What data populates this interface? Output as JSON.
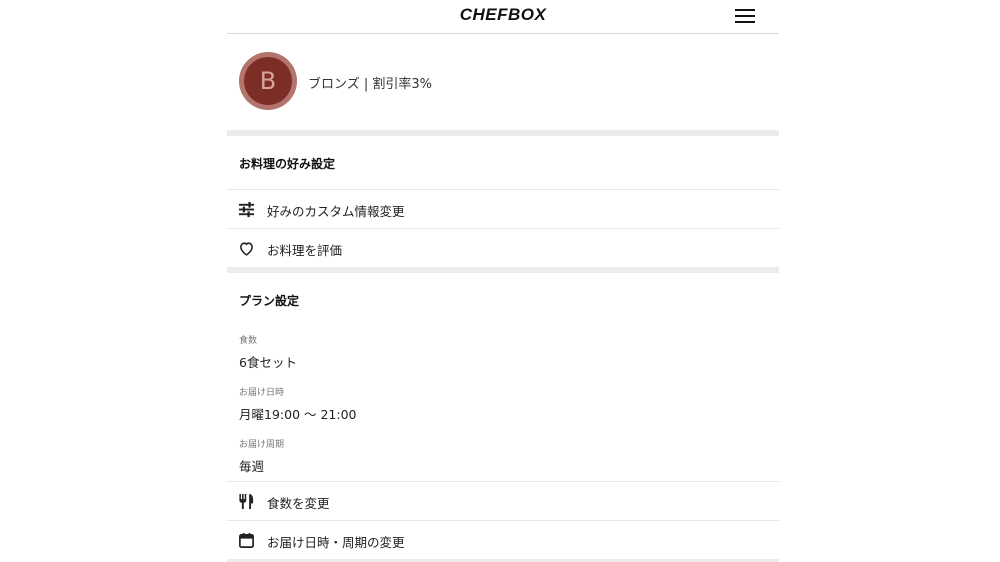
{
  "header": {
    "logo": "CHEFBOX",
    "menu_icon": "hamburger-menu-icon"
  },
  "profile": {
    "avatar_letter": "B",
    "rank_text": "ブロンズ | 割引率3%",
    "colors": {
      "avatar_ring": "#b2746c",
      "avatar_fill": "#7c2e26"
    }
  },
  "preferences": {
    "title": "お料理の好み設定",
    "items": [
      {
        "label": "好みのカスタム情報変更",
        "icon": "sliders-icon"
      },
      {
        "label": "お料理を評価",
        "icon": "heart-icon"
      }
    ]
  },
  "plan": {
    "title": "プラン設定",
    "fields": [
      {
        "label": "食数",
        "value": "6食セット"
      },
      {
        "label": "お届け日時",
        "value": "月曜19:00 〜 21:00"
      },
      {
        "label": "お届け周期",
        "value": "毎週"
      }
    ],
    "actions": [
      {
        "label": "食数を変更",
        "icon": "fork-knife-icon"
      },
      {
        "label": "お届け日時・周期の変更",
        "icon": "calendar-icon"
      }
    ]
  }
}
